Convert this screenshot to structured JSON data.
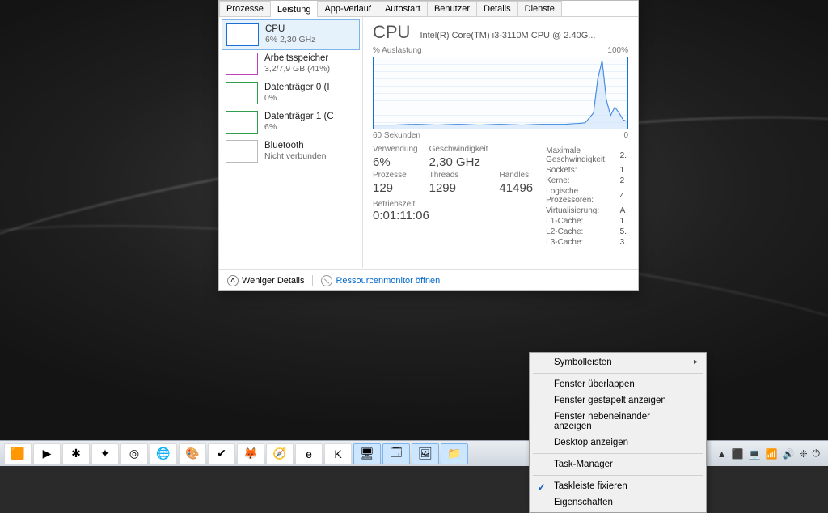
{
  "tabs": [
    "Prozesse",
    "Leistung",
    "App-Verlauf",
    "Autostart",
    "Benutzer",
    "Details",
    "Dienste"
  ],
  "active_tab": 1,
  "sidebar": [
    {
      "title": "CPU",
      "sub": "6%  2,30 GHz"
    },
    {
      "title": "Arbeitsspeicher",
      "sub": "3,2/7,9 GB (41%)"
    },
    {
      "title": "Datenträger 0 (I",
      "sub": "0%"
    },
    {
      "title": "Datenträger 1 (C",
      "sub": "6%"
    },
    {
      "title": "Bluetooth",
      "sub": "Nicht verbunden"
    }
  ],
  "cpu": {
    "heading": "CPU",
    "full": "Intel(R) Core(TM) i3-3110M CPU @ 2.40G...",
    "top_left": "% Auslastung",
    "top_right": "100%",
    "bot_left": "60 Sekunden",
    "bot_right": "0",
    "labels": {
      "usage": "Verwendung",
      "speed": "Geschwindigkeit",
      "proc": "Prozesse",
      "thr": "Threads",
      "han": "Handles",
      "uptime": "Betriebszeit"
    },
    "values": {
      "usage": "6%",
      "speed": "2,30 GHz",
      "proc": "129",
      "thr": "1299",
      "han": "41496",
      "uptime": "0:01:11:06"
    },
    "right": [
      [
        "Maximale Geschwindigkeit:",
        "2."
      ],
      [
        "Sockets:",
        "1"
      ],
      [
        "Kerne:",
        "2"
      ],
      [
        "Logische Prozessoren:",
        "4"
      ],
      [
        "Virtualisierung:",
        "A"
      ],
      [
        "L1-Cache:",
        "1."
      ],
      [
        "L2-Cache:",
        "5."
      ],
      [
        "L3-Cache:",
        "3."
      ]
    ]
  },
  "footer": {
    "less": "Weniger Details",
    "resmon": "Ressourcenmonitor öffnen"
  },
  "context_menu": {
    "toolbars": "Symbolleisten",
    "cascade": "Fenster überlappen",
    "stacked": "Fenster gestapelt anzeigen",
    "sidebyside": "Fenster nebeneinander anzeigen",
    "desktop": "Desktop anzeigen",
    "taskmgr": "Task-Manager",
    "lock": "Taskleiste fixieren",
    "props": "Eigenschaften"
  },
  "taskbar_icons": [
    "🟧",
    "▶",
    "✱",
    "✦",
    "◎",
    "🌐",
    "🎨",
    "✔",
    "🦊",
    "🧭",
    "e",
    "K",
    "🖥",
    "🗔",
    "🖼",
    "📁"
  ],
  "tray_icons": [
    "▲",
    "⬛",
    "💻",
    "📶",
    "🔊",
    "❊",
    "⏻"
  ],
  "chart_data": {
    "type": "line",
    "title": "% Auslastung",
    "xlabel": "60 Sekunden",
    "ylabel": "%",
    "ylim": [
      0,
      100
    ],
    "x_seconds_ago": [
      60,
      55,
      50,
      45,
      40,
      35,
      30,
      25,
      20,
      15,
      12,
      10,
      8,
      7,
      6,
      5,
      4,
      3,
      2,
      1,
      0
    ],
    "values": [
      5,
      5,
      6,
      5,
      6,
      5,
      6,
      5,
      6,
      6,
      7,
      8,
      22,
      70,
      95,
      40,
      18,
      30,
      22,
      12,
      10
    ]
  }
}
